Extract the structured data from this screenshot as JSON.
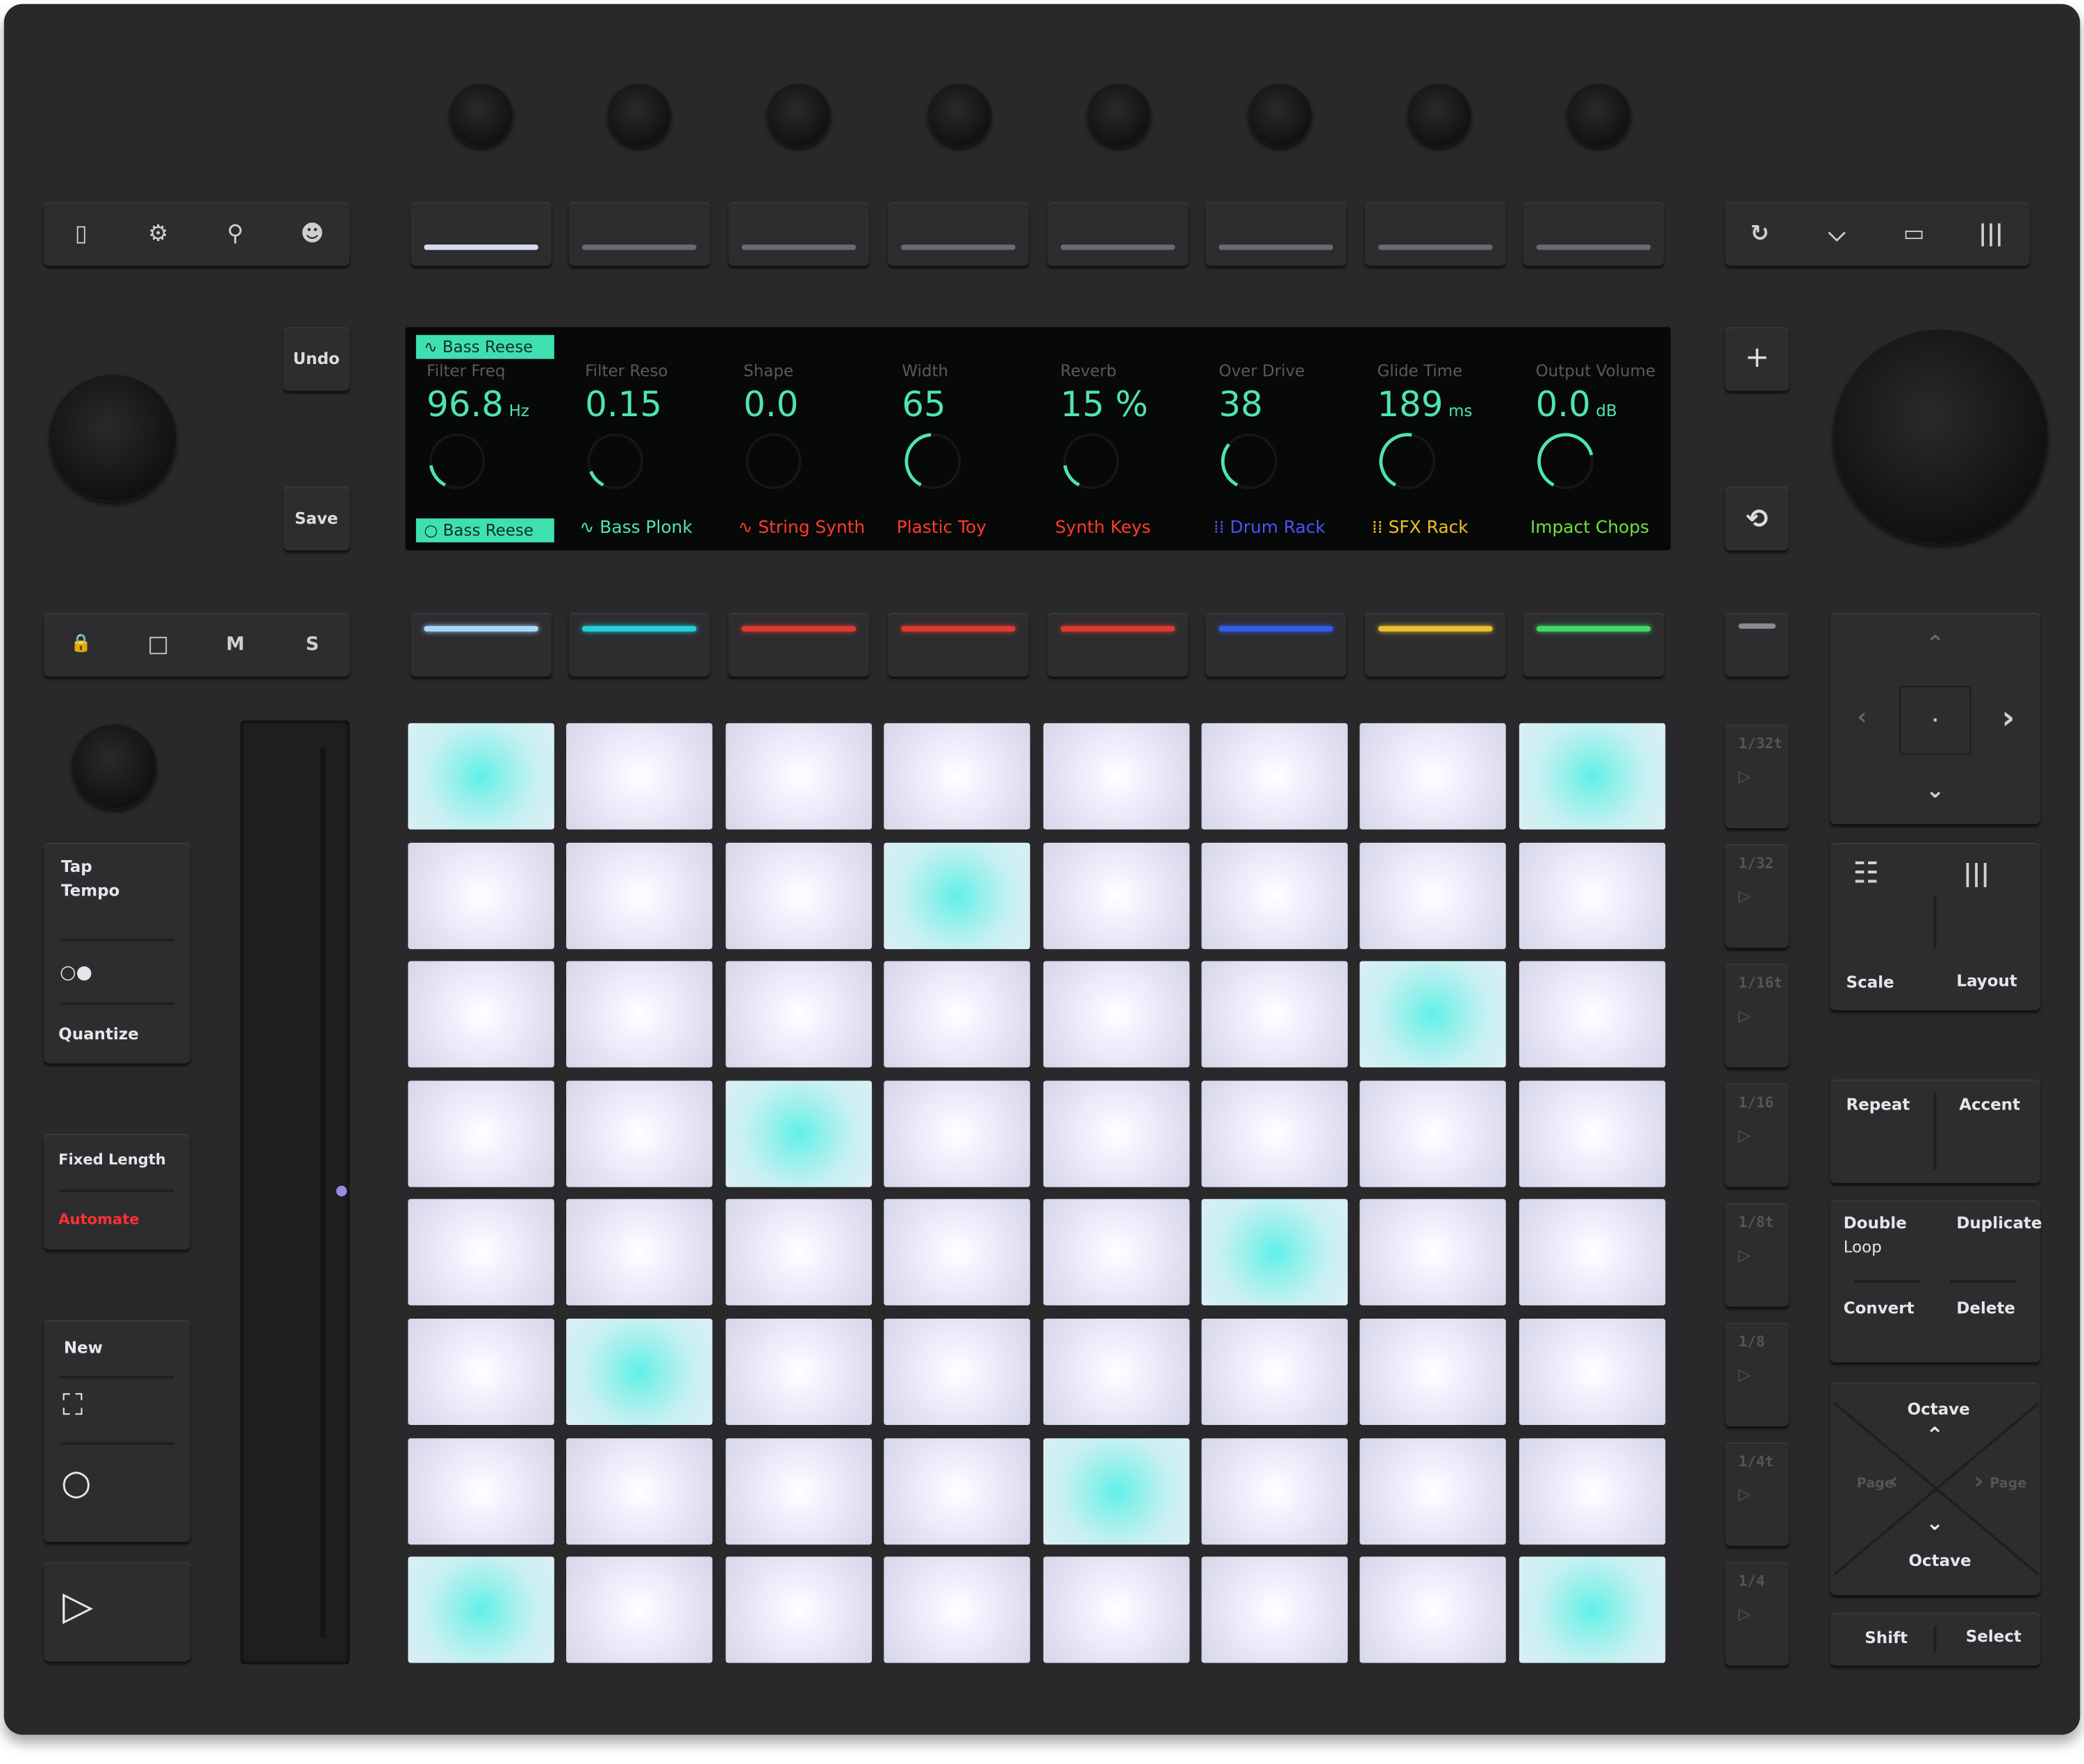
{
  "top_left_icons": [
    "file-icon",
    "gear-icon",
    "lightbulb-icon",
    "user-icon"
  ],
  "top_right_icons": [
    "loop-icon",
    "mixer-icon",
    "clip-icon",
    "columns-icon"
  ],
  "buttons": {
    "undo": "Undo",
    "save": "Save",
    "add": "+",
    "convert_icon": "⟲"
  },
  "track_controls": {
    "lock": "🔒",
    "stop": "□",
    "mute": "M",
    "solo": "S"
  },
  "display": {
    "device_tag": "∿ Bass Reese",
    "params": [
      {
        "name": "Filter Freq",
        "value": "96.8",
        "unit": "Hz",
        "level": 0.2
      },
      {
        "name": "Filter Reso",
        "value": "0.15",
        "unit": "",
        "level": 0.15
      },
      {
        "name": "Shape",
        "value": "0.0",
        "unit": "",
        "level": 0
      },
      {
        "name": "Width",
        "value": "65",
        "unit": "",
        "level": 0.55
      },
      {
        "name": "Reverb",
        "value": "15 %",
        "unit": "",
        "level": 0.2
      },
      {
        "name": "Over Drive",
        "value": "38",
        "unit": "",
        "level": 0.38
      },
      {
        "name": "Glide Time",
        "value": "189",
        "unit": "ms",
        "level": 0.6
      },
      {
        "name": "Output Volume",
        "value": "0.0",
        "unit": "dB",
        "level": 0.85
      }
    ],
    "tracks": [
      {
        "name": "○ Bass Reese",
        "color": "#3fe0b0",
        "selected": true
      },
      {
        "name": "∿ Bass Plonk",
        "color": "#4fe3b5"
      },
      {
        "name": "∿ String Synth",
        "color": "#ff3a2a"
      },
      {
        "name": "Plastic Toy",
        "color": "#ff3a2a"
      },
      {
        "name": "Synth Keys",
        "color": "#ff3a2a"
      },
      {
        "name": "⁞⁞ Drum Rack",
        "color": "#4a52ff"
      },
      {
        "name": "⁞⁞ SFX Rack",
        "color": "#f0c020"
      },
      {
        "name": "Impact Chops",
        "color": "#70e040"
      }
    ]
  },
  "track_select_colors": [
    "#a8d8ff",
    "#22d0dc",
    "#e03a30",
    "#e03a30",
    "#e03a30",
    "#2e5ee8",
    "#e8c030",
    "#40d868"
  ],
  "left": {
    "tap": "Tap",
    "tempo": "Tempo",
    "metronome": "○●",
    "quantize": "Quantize",
    "fixed_length": "Fixed Length",
    "automate": "Automate",
    "new": "New",
    "duplicate_icon": "⛶",
    "record_icon": "○",
    "play_icon": "▷"
  },
  "scenes": [
    "1/32t",
    "1/32",
    "1/16t",
    "1/16",
    "1/8t",
    "1/8",
    "1/4t",
    "1/4"
  ],
  "right": {
    "scale": "Scale",
    "layout": "Layout",
    "repeat": "Repeat",
    "accent": "Accent",
    "double": "Double",
    "loop": "Loop",
    "duplicate": "Duplicate",
    "convert": "Convert",
    "delete": "Delete",
    "octave_up": "Octave",
    "octave_down": "Octave",
    "page_left": "Page",
    "page_right": "Page",
    "shift": "Shift",
    "select": "Select"
  },
  "pads": [
    [
      "cyan",
      "white",
      "white",
      "white",
      "white",
      "white",
      "white",
      "cyan"
    ],
    [
      "white",
      "white",
      "white",
      "cyan",
      "white",
      "white",
      "white",
      "white"
    ],
    [
      "white",
      "white",
      "white",
      "white",
      "white",
      "white",
      "cyan",
      "white"
    ],
    [
      "white",
      "white",
      "cyan",
      "white",
      "white",
      "white",
      "white",
      "white"
    ],
    [
      "white",
      "white",
      "white",
      "white",
      "white",
      "cyan",
      "white",
      "white"
    ],
    [
      "white",
      "cyan",
      "white",
      "white",
      "white",
      "white",
      "white",
      "white"
    ],
    [
      "white",
      "white",
      "white",
      "white",
      "cyan",
      "white",
      "white",
      "white"
    ],
    [
      "cyan",
      "white",
      "white",
      "white",
      "white",
      "white",
      "white",
      "cyan"
    ]
  ],
  "colors": {
    "accent": "#4fe3b5",
    "automate": "#ff3030"
  }
}
